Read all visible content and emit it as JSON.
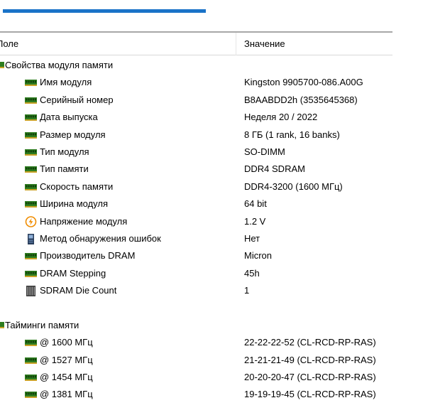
{
  "header": {
    "field_label": "Поле",
    "value_label": "Значение"
  },
  "groups": [
    {
      "label": "Свойства модуля памяти",
      "items": [
        {
          "label": "Имя модуля",
          "value": "Kingston 9905700-086.A00G",
          "icon": "memory-module-icon"
        },
        {
          "label": "Серийный номер",
          "value": "B8AABDD2h (3535645368)",
          "icon": "memory-module-icon"
        },
        {
          "label": "Дата выпуска",
          "value": "Неделя 20 / 2022",
          "icon": "memory-module-icon"
        },
        {
          "label": "Размер модуля",
          "value": "8 ГБ (1 rank, 16 banks)",
          "icon": "memory-module-icon"
        },
        {
          "label": "Тип модуля",
          "value": "SO-DIMM",
          "icon": "memory-module-icon"
        },
        {
          "label": "Тип памяти",
          "value": "DDR4 SDRAM",
          "icon": "memory-module-icon"
        },
        {
          "label": "Скорость памяти",
          "value": "DDR4-3200 (1600 МГц)",
          "icon": "memory-module-icon"
        },
        {
          "label": "Ширина модуля",
          "value": "64 bit",
          "icon": "memory-module-icon"
        },
        {
          "label": "Напряжение модуля",
          "value": "1.2 V",
          "icon": "voltage-icon"
        },
        {
          "label": "Метод обнаружения ошибок",
          "value": "Нет",
          "icon": "error-detection-icon"
        },
        {
          "label": "Производитель DRAM",
          "value": "Micron",
          "icon": "memory-module-icon"
        },
        {
          "label": "DRAM Stepping",
          "value": "45h",
          "icon": "memory-module-icon"
        },
        {
          "label": "SDRAM Die Count",
          "value": "1",
          "icon": "die-count-icon"
        }
      ]
    },
    {
      "label": "Тайминги памяти",
      "items": [
        {
          "label": "@ 1600 МГц",
          "value": "22-22-22-52  (CL-RCD-RP-RAS)",
          "icon": "memory-module-icon"
        },
        {
          "label": "@ 1527 МГц",
          "value": "21-21-21-49  (CL-RCD-RP-RAS)",
          "icon": "memory-module-icon"
        },
        {
          "label": "@ 1454 МГц",
          "value": "20-20-20-47  (CL-RCD-RP-RAS)",
          "icon": "memory-module-icon"
        },
        {
          "label": "@ 1381 МГц",
          "value": "19-19-19-45  (CL-RCD-RP-RAS)",
          "icon": "memory-module-icon"
        }
      ]
    }
  ],
  "colors": {
    "accent_bar": "#1a73c8",
    "memory_icon": "#2e7d1f",
    "voltage_icon": "#f08c00"
  }
}
